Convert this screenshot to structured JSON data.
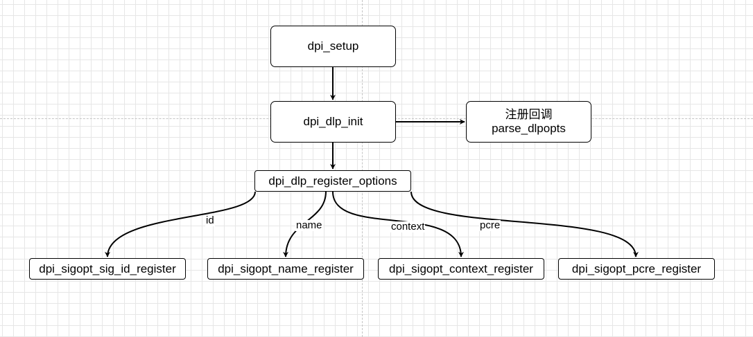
{
  "nodes": {
    "setup": "dpi_setup",
    "init": "dpi_dlp_init",
    "callback_line1": "注册回调",
    "callback_line2": "parse_dlpopts",
    "register_options": "dpi_dlp_register_options",
    "sig_id": "dpi_sigopt_sig_id_register",
    "name": "dpi_sigopt_name_register",
    "context": "dpi_sigopt_context_register",
    "pcre": "dpi_sigopt_pcre_register"
  },
  "edge_labels": {
    "id": "id",
    "name": "name",
    "context": "context",
    "pcre": "pcre"
  }
}
